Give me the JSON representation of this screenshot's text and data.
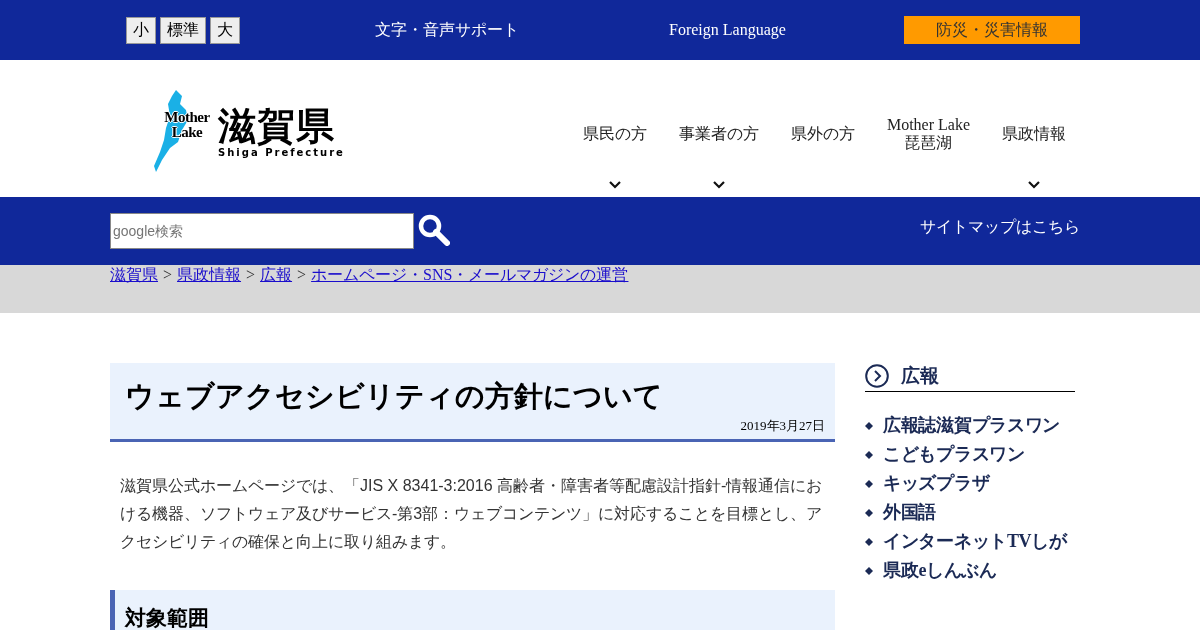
{
  "top_bar": {
    "font_sizes": [
      "小",
      "標準",
      "大"
    ],
    "support_link": "文字・音声サポート",
    "language_link": "Foreign Language",
    "disaster_button": "防災・災害情報"
  },
  "logo": {
    "mark_text": "Mother Lake",
    "name": "滋賀県",
    "subtitle": "Shiga Prefecture"
  },
  "nav": [
    {
      "label": "県民の方",
      "dropdown": true
    },
    {
      "label": "事業者の方",
      "dropdown": true
    },
    {
      "label": "県外の方",
      "dropdown": false
    },
    {
      "label": "Mother Lake\n琵琶湖",
      "dropdown": false
    },
    {
      "label": "県政情報",
      "dropdown": true
    }
  ],
  "search": {
    "placeholder": "google検索"
  },
  "sitemap_link": "サイトマップはこちら",
  "breadcrumb": [
    {
      "kind": "link",
      "text": "滋賀県"
    },
    {
      "kind": "separator",
      "text": ">"
    },
    {
      "kind": "link",
      "text": "県政情報"
    },
    {
      "kind": "separator",
      "text": ">"
    },
    {
      "kind": "link",
      "text": "広報"
    },
    {
      "kind": "separator",
      "text": ">"
    },
    {
      "kind": "link",
      "text": "ホームページ・SNS・メールマガジンの運営"
    }
  ],
  "article": {
    "title": "ウェブアクセシビリティの方針について",
    "date": "2019年3月27日",
    "body": "滋賀県公式ホームページでは、「JIS X 8341-3:2016 高齢者・障害者等配慮設計指針-情報通信における機器、ソフトウェア及びサービス-第3部：ウェブコンテンツ」に対応することを目標とし、アクセシビリティの確保と向上に取り組みます。",
    "section_heading": "対象範囲"
  },
  "sidebar": {
    "heading": "広報",
    "items": [
      "広報誌滋賀プラスワン",
      "こどもプラスワン",
      "キッズプラザ",
      "外国語",
      "インターネットTVしが",
      "県政eしんぶん"
    ]
  }
}
